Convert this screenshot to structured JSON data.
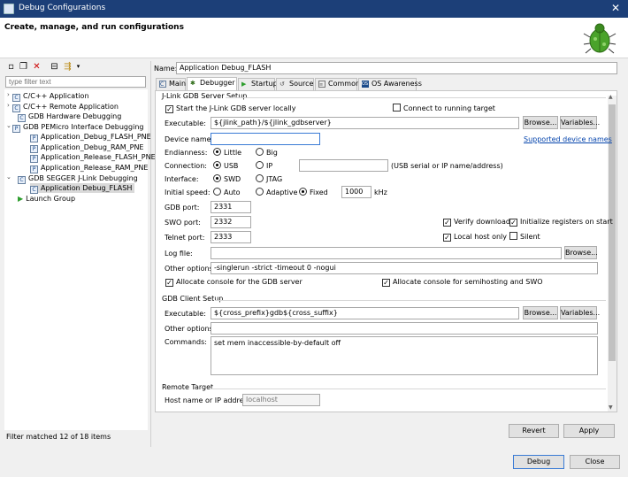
{
  "window": {
    "title": "Debug Configurations"
  },
  "header": {
    "title": "Create, manage, and run configurations"
  },
  "sidebar": {
    "filter_placeholder": "type filter text",
    "tree": [
      {
        "label": "C/C++ Application",
        "icon": "C"
      },
      {
        "label": "C/C++ Remote Application",
        "icon": "C"
      },
      {
        "label": "GDB Hardware Debugging",
        "icon": "C"
      },
      {
        "label": "GDB PEMicro Interface Debugging",
        "icon": "P"
      },
      {
        "label": "Application_Debug_FLASH_PNE",
        "icon": "P"
      },
      {
        "label": "Application_Debug_RAM_PNE",
        "icon": "P"
      },
      {
        "label": "Application_Release_FLASH_PNE",
        "icon": "P"
      },
      {
        "label": "Application_Release_RAM_PNE",
        "icon": "P"
      },
      {
        "label": "GDB SEGGER J-Link Debugging",
        "icon": "C"
      },
      {
        "label": "Application Debug_FLASH",
        "icon": "C"
      },
      {
        "label": "Launch Group",
        "icon": "launch"
      }
    ],
    "status": "Filter matched 12 of 18 items"
  },
  "config": {
    "name_label": "Name:",
    "name_value": "Application Debug_FLASH",
    "tabs": [
      "Main",
      "Debugger",
      "Startup",
      "Source",
      "Common",
      "OS Awareness"
    ],
    "active_tab": "Debugger"
  },
  "server": {
    "group": "J-Link GDB Server Setup",
    "start_locally": "Start the J-Link GDB server locally",
    "connect_running": "Connect to running target",
    "executable_label": "Executable:",
    "executable_value": "${jlink_path}/${jlink_gdbserver}",
    "browse": "Browse...",
    "variables": "Variables...",
    "device_label": "Device name:",
    "device_value": "",
    "supported_link": "Supported device names",
    "endianness_label": "Endianness:",
    "little": "Little",
    "big": "Big",
    "connection_label": "Connection:",
    "usb": "USB",
    "ip": "IP",
    "ip_hint": "(USB serial or IP name/address)",
    "interface_label": "Interface:",
    "swd": "SWD",
    "jtag": "JTAG",
    "speed_label": "Initial speed:",
    "auto": "Auto",
    "adaptive": "Adaptive",
    "fixed": "Fixed",
    "speed_value": "1000",
    "speed_unit": "kHz",
    "gdb_port_label": "GDB port:",
    "gdb_port": "2331",
    "swo_port_label": "SWO port:",
    "swo_port": "2332",
    "telnet_port_label": "Telnet port:",
    "telnet_port": "2333",
    "verify_downloads": "Verify downloads",
    "init_registers": "Initialize registers on start",
    "local_host_only": "Local host only",
    "silent": "Silent",
    "log_label": "Log file:",
    "log_value": "",
    "other_label": "Other options:",
    "other_value": "-singlerun -strict -timeout 0 -nogui",
    "alloc_gdb": "Allocate console for the GDB server",
    "alloc_semi": "Allocate console for semihosting and SWO"
  },
  "client": {
    "group": "GDB Client Setup",
    "executable_label": "Executable:",
    "executable_value": "${cross_prefix}gdb${cross_suffix}",
    "browse": "Browse...",
    "variables": "Variables...",
    "other_label": "Other options:",
    "other_value": "",
    "commands_label": "Commands:",
    "commands_value": "set mem inaccessible-by-default off"
  },
  "remote": {
    "group": "Remote Target",
    "host_label": "Host name or IP address:",
    "host_value": "localhost"
  },
  "buttons": {
    "revert": "Revert",
    "apply": "Apply",
    "debug": "Debug",
    "close": "Close"
  },
  "colors": {
    "titlebar": "#1c3f78",
    "link": "#0645ad",
    "focus": "#3a7bd5"
  }
}
